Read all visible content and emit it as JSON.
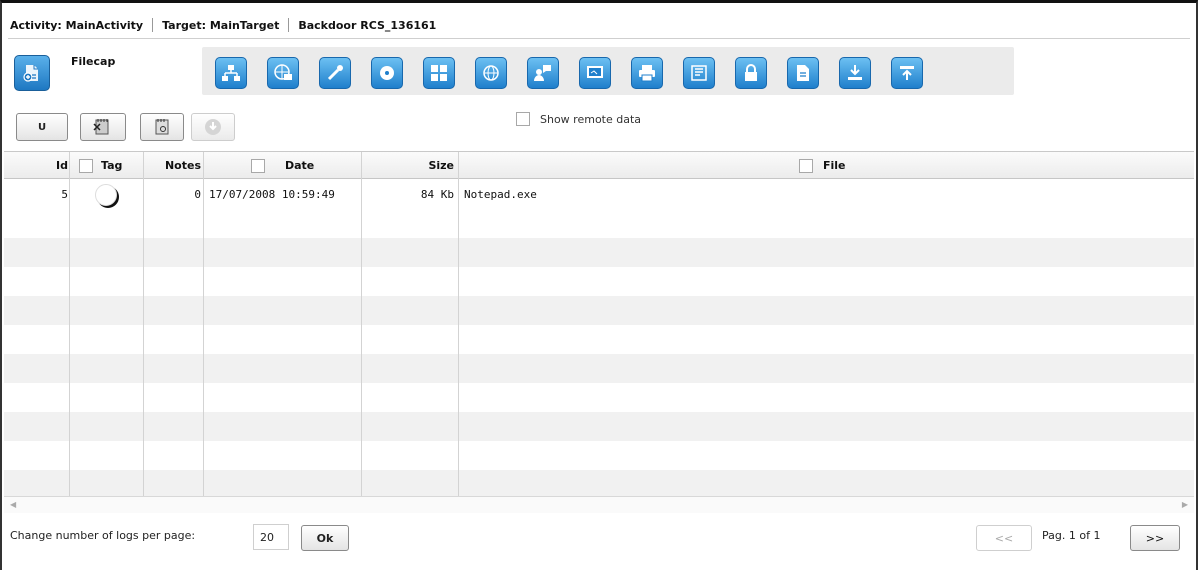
{
  "breadcrumb": {
    "activity": "Activity: MainActivity",
    "target": "Target: MainTarget",
    "backdoor": "Backdoor RCS_136161"
  },
  "module": {
    "title": "Filecap",
    "icon": "filecap-icon"
  },
  "toolbar": {
    "buttons": [
      {
        "name": "network-tree-icon"
      },
      {
        "name": "globe-chat-icon"
      },
      {
        "name": "microphone-icon"
      },
      {
        "name": "disk-icon"
      },
      {
        "name": "grid-icon"
      },
      {
        "name": "web-icon"
      },
      {
        "name": "user-chat-icon"
      },
      {
        "name": "screen-icon"
      },
      {
        "name": "printer-icon"
      },
      {
        "name": "keyboard-icon"
      },
      {
        "name": "lock-icon"
      },
      {
        "name": "document-icon"
      },
      {
        "name": "download-icon"
      },
      {
        "name": "upload-icon"
      }
    ]
  },
  "actions": {
    "u_label": "U",
    "show_remote_label": "Show remote data"
  },
  "table": {
    "columns": {
      "id": "Id",
      "tag": "Tag",
      "notes": "Notes",
      "date": "Date",
      "size": "Size",
      "file": "File"
    },
    "rows": [
      {
        "id": "5",
        "notes": "0",
        "date": "17/07/2008 10:59:49",
        "size": "84 Kb",
        "file": "Notepad.exe"
      }
    ]
  },
  "footer": {
    "per_page_label": "Change number of logs per page:",
    "per_page_value": "20",
    "ok_label": "Ok",
    "prev_label": "<<",
    "page_label": "Pag. 1 of 1",
    "next_label": ">>"
  },
  "colors": {
    "accent": "#1f7fcc",
    "toolbar_bg": "#ebebeb"
  }
}
